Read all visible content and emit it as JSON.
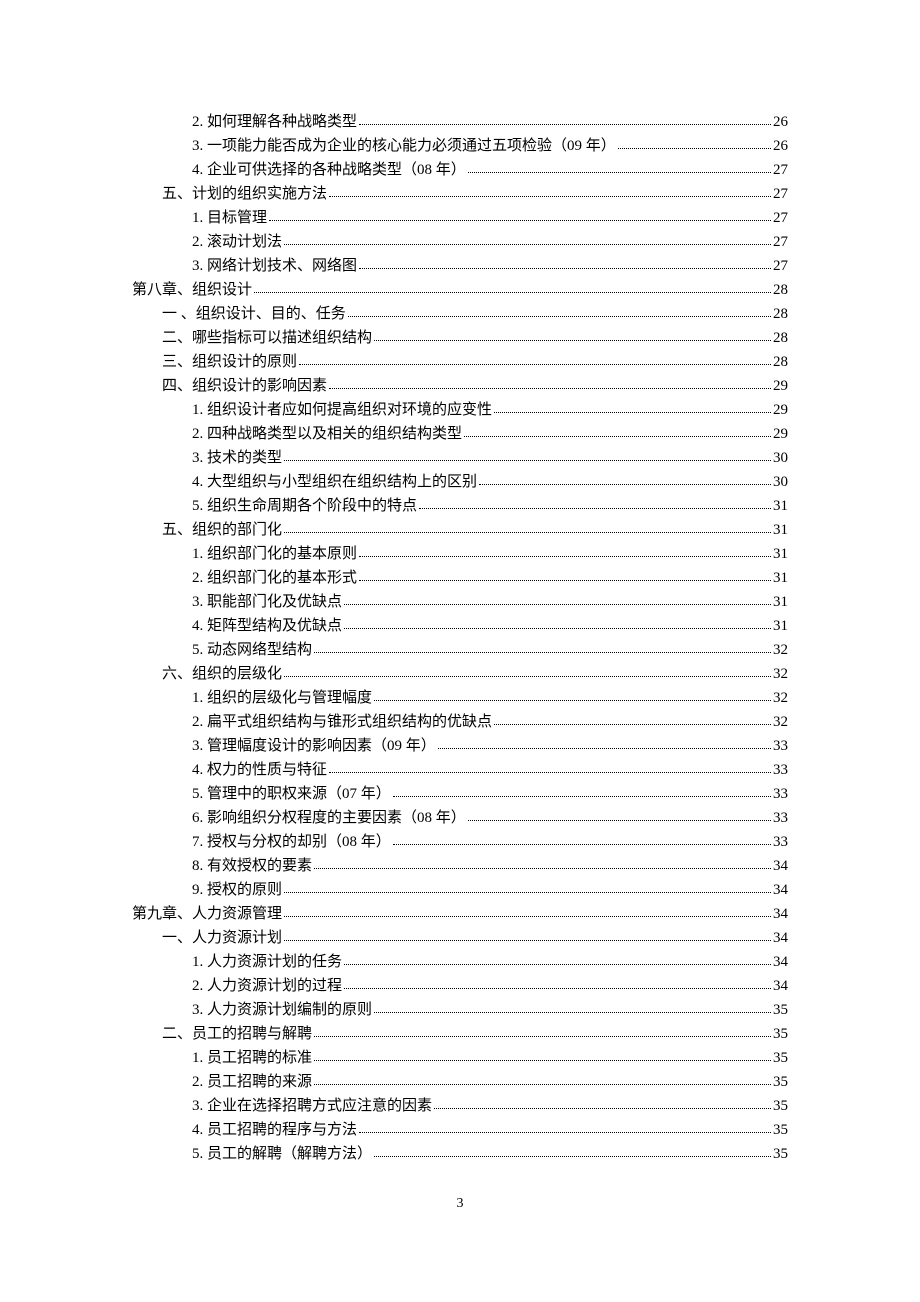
{
  "page_number": "3",
  "entries": [
    {
      "level": "item",
      "text": "2. 如何理解各种战略类型",
      "page": "26"
    },
    {
      "level": "item",
      "text": "3. 一项能力能否成为企业的核心能力必须通过五项检验（09 年）",
      "page": "26"
    },
    {
      "level": "item",
      "text": "4. 企业可供选择的各种战略类型（08 年）",
      "page": "27"
    },
    {
      "level": "section",
      "text": "五、计划的组织实施方法",
      "page": "27"
    },
    {
      "level": "item",
      "text": "1. 目标管理",
      "page": "27"
    },
    {
      "level": "item",
      "text": "2. 滚动计划法",
      "page": "27"
    },
    {
      "level": "item",
      "text": "3. 网络计划技术、网络图",
      "page": "27"
    },
    {
      "level": "chapter",
      "text": "第八章、组织设计",
      "page": "28"
    },
    {
      "level": "section",
      "text": "一 、组织设计、目的、任务",
      "page": "28"
    },
    {
      "level": "section",
      "text": "二、哪些指标可以描述组织结构",
      "page": "28"
    },
    {
      "level": "section",
      "text": "三、组织设计的原则",
      "page": "28"
    },
    {
      "level": "section",
      "text": "四、组织设计的影响因素",
      "page": "29"
    },
    {
      "level": "item",
      "text": "1. 组织设计者应如何提高组织对环境的应变性",
      "page": "29"
    },
    {
      "level": "item",
      "text": "2. 四种战略类型以及相关的组织结构类型",
      "page": "29"
    },
    {
      "level": "item",
      "text": "3. 技术的类型",
      "page": "30"
    },
    {
      "level": "item",
      "text": "4. 大型组织与小型组织在组织结构上的区别",
      "page": "30"
    },
    {
      "level": "item",
      "text": "5. 组织生命周期各个阶段中的特点",
      "page": "31"
    },
    {
      "level": "section",
      "text": "五、组织的部门化",
      "page": "31"
    },
    {
      "level": "item",
      "text": "1. 组织部门化的基本原则",
      "page": "31"
    },
    {
      "level": "item",
      "text": "2. 组织部门化的基本形式",
      "page": "31"
    },
    {
      "level": "item",
      "text": "3. 职能部门化及优缺点",
      "page": "31"
    },
    {
      "level": "item",
      "text": "4. 矩阵型结构及优缺点",
      "page": "31"
    },
    {
      "level": "item",
      "text": "5. 动态网络型结构",
      "page": "32"
    },
    {
      "level": "section",
      "text": "六、组织的层级化",
      "page": "32"
    },
    {
      "level": "item",
      "text": "1. 组织的层级化与管理幅度",
      "page": "32"
    },
    {
      "level": "item",
      "text": "2. 扁平式组织结构与锥形式组织结构的优缺点",
      "page": "32"
    },
    {
      "level": "item",
      "text": "3. 管理幅度设计的影响因素（09 年）",
      "page": "33"
    },
    {
      "level": "item",
      "text": "4. 权力的性质与特征",
      "page": "33"
    },
    {
      "level": "item",
      "text": "5. 管理中的职权来源（07 年）",
      "page": "33"
    },
    {
      "level": "item",
      "text": "6. 影响组织分权程度的主要因素（08 年）",
      "page": "33"
    },
    {
      "level": "item",
      "text": "7. 授权与分权的却别（08 年）",
      "page": "33"
    },
    {
      "level": "item",
      "text": "8. 有效授权的要素",
      "page": "34"
    },
    {
      "level": "item",
      "text": "9. 授权的原则",
      "page": "34"
    },
    {
      "level": "chapter",
      "text": "第九章、人力资源管理",
      "page": "34"
    },
    {
      "level": "section",
      "text": "一、人力资源计划",
      "page": "34"
    },
    {
      "level": "item",
      "text": "1. 人力资源计划的任务",
      "page": "34"
    },
    {
      "level": "item",
      "text": "2. 人力资源计划的过程",
      "page": "34"
    },
    {
      "level": "item",
      "text": "3. 人力资源计划编制的原则",
      "page": "35"
    },
    {
      "level": "section",
      "text": "二、员工的招聘与解聘",
      "page": "35"
    },
    {
      "level": "item",
      "text": "1. 员工招聘的标准",
      "page": "35"
    },
    {
      "level": "item",
      "text": "2. 员工招聘的来源",
      "page": "35"
    },
    {
      "level": "item",
      "text": "3. 企业在选择招聘方式应注意的因素",
      "page": "35"
    },
    {
      "level": "item",
      "text": "4. 员工招聘的程序与方法",
      "page": "35"
    },
    {
      "level": "item",
      "text": "5. 员工的解聘（解聘方法）",
      "page": "35"
    }
  ]
}
